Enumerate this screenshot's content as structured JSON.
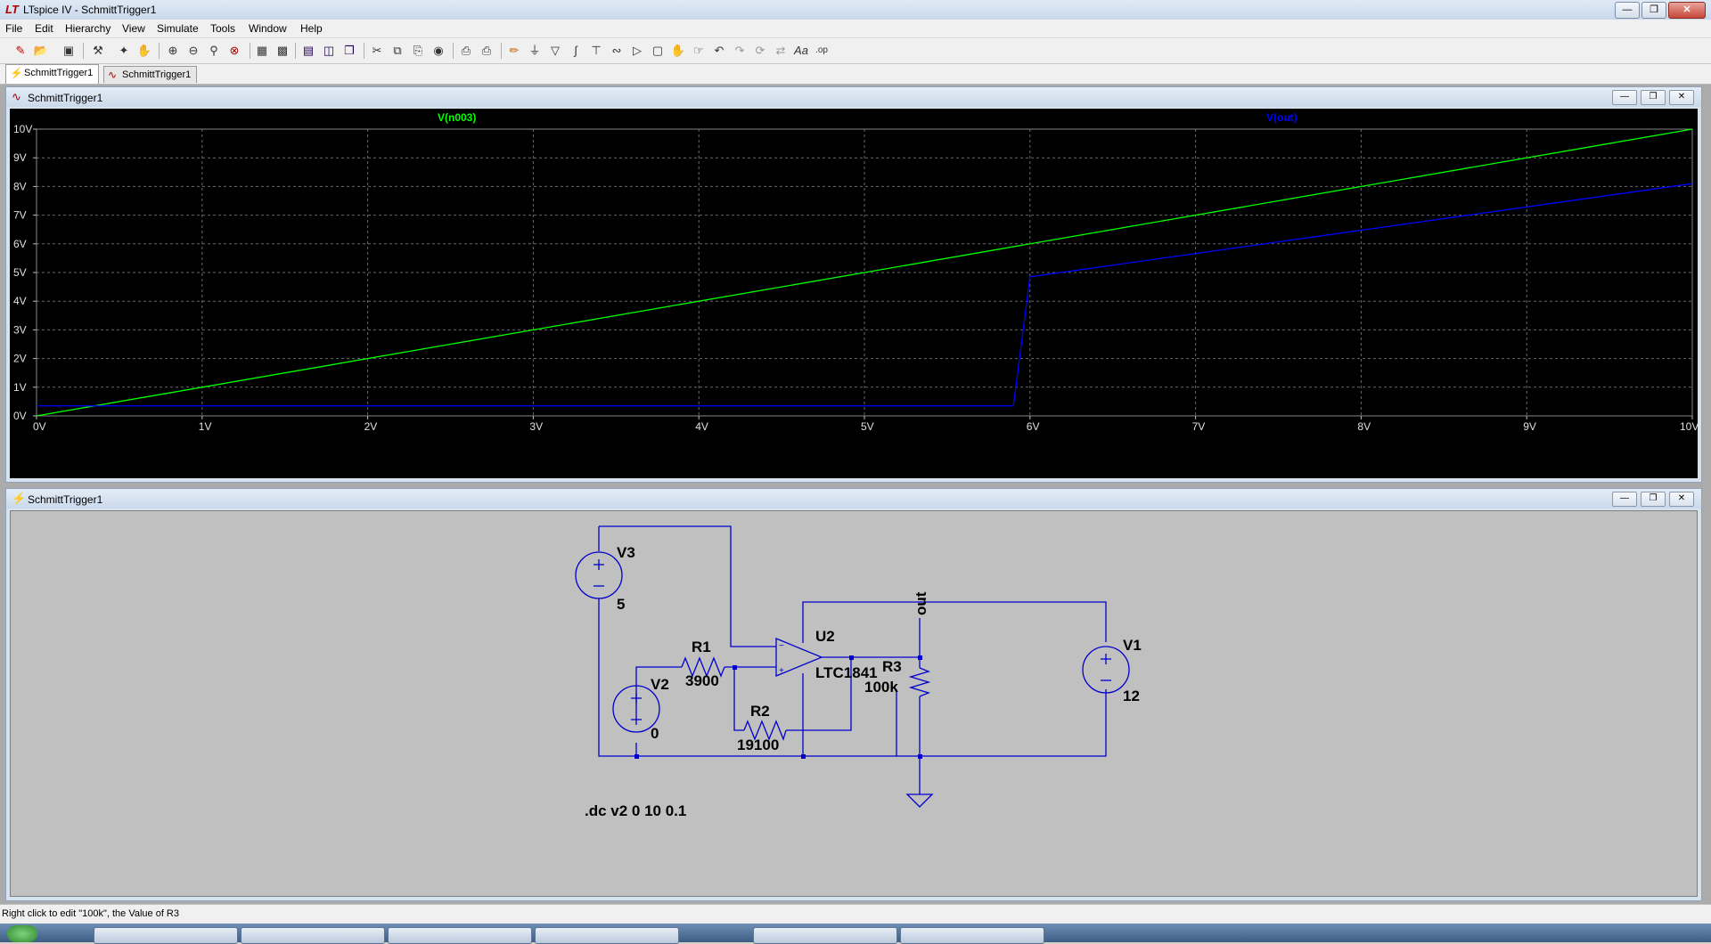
{
  "window": {
    "title": "LTspice IV - SchmittTrigger1",
    "app_icon": "LT",
    "controls": [
      "minimize",
      "restore",
      "close"
    ]
  },
  "menu": [
    "File",
    "Edit",
    "Hierarchy",
    "View",
    "Simulate",
    "Tools",
    "Window",
    "Help"
  ],
  "toolbar_icons": [
    "new-schematic-icon",
    "open-icon",
    "save-icon",
    "control-panel-icon",
    "run-icon",
    "pan-icon",
    "zoom-in-icon",
    "zoom-out-icon",
    "zoom-area-icon",
    "zoom-fit-icon",
    "autorange-icon",
    "grid-icon",
    "tile-horizontal-icon",
    "tile-vertical-icon",
    "cascade-icon",
    "cut-icon",
    "copy-icon",
    "paste-icon",
    "find-icon",
    "print-icon",
    "print-setup-icon",
    "wire-icon",
    "ground-icon",
    "label-net-icon",
    "resistor-icon",
    "capacitor-icon",
    "inductor-icon",
    "diode-icon",
    "component-icon",
    "move-icon",
    "drag-icon",
    "undo-icon",
    "redo-icon",
    "rotate-icon",
    "mirror-icon",
    "text-icon",
    "spice-directive-icon"
  ],
  "tabs": [
    {
      "label": "SchmittTrigger1",
      "icon": "schematic-icon",
      "active": true
    },
    {
      "label": "SchmittTrigger1",
      "icon": "waveform-icon",
      "active": false
    }
  ],
  "waveform_window": {
    "title": "SchmittTrigger1",
    "icon": "waveform-icon"
  },
  "schematic_window": {
    "title": "SchmittTrigger1",
    "icon": "schematic-icon"
  },
  "chart_data": {
    "type": "line",
    "title": "",
    "xlabel": "",
    "ylabel": "",
    "x_ticks": [
      "0V",
      "1V",
      "2V",
      "3V",
      "4V",
      "5V",
      "6V",
      "7V",
      "8V",
      "9V",
      "10V"
    ],
    "y_ticks": [
      "0V",
      "1V",
      "2V",
      "3V",
      "4V",
      "5V",
      "6V",
      "7V",
      "8V",
      "9V",
      "10V"
    ],
    "xlim": [
      0,
      10
    ],
    "ylim": [
      0,
      10
    ],
    "grid": true,
    "background": "#000000",
    "series": [
      {
        "name": "V(n003)",
        "color": "#00ff00",
        "x": [
          0,
          10
        ],
        "y": [
          0,
          10
        ]
      },
      {
        "name": "V(out)",
        "color": "#0000ff",
        "x": [
          0,
          5.9,
          6.0,
          10
        ],
        "y": [
          0.35,
          0.35,
          4.85,
          8.1
        ]
      }
    ]
  },
  "schematic": {
    "components": {
      "v3_name": "V3",
      "v3_value": "5",
      "v2_name": "V2",
      "v2_value": "0",
      "v1_name": "V1",
      "v1_value": "12",
      "r1_name": "R1",
      "r1_value": "3900",
      "r2_name": "R2",
      "r2_value": "19100",
      "r3_name": "R3",
      "r3_value": "100k",
      "u2_name": "U2",
      "u2_value": "LTC1841"
    },
    "net_label": "out",
    "directive": ".dc v2 0 10 0.1",
    "wire_color": "#0000cc"
  },
  "status": {
    "text": "Right click to edit \"100k\", the Value of R3"
  }
}
